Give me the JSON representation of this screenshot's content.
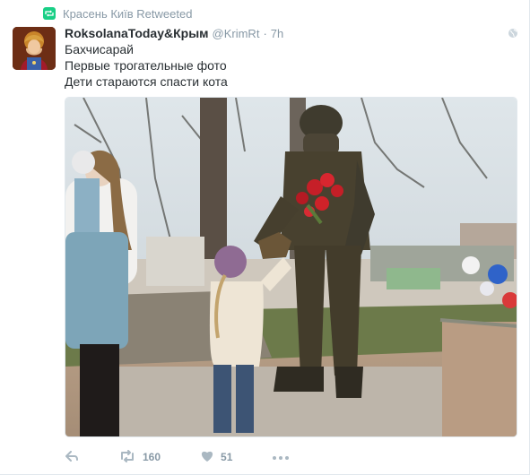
{
  "retweet": {
    "label": "Красень Київ Retweeted",
    "icon": "retweet-icon"
  },
  "tweet": {
    "author_name": "RoksolanaToday&Крым",
    "author_handle": "@KrimRt",
    "separator": "·",
    "time": "7h",
    "lines": [
      "Бахчисарай",
      "Первые трогательные фото",
      "Дети стараются спасти кота"
    ],
    "avatar_icon": "user-avatar",
    "globe_icon": "globe-icon"
  },
  "actions": {
    "reply_icon": "reply-icon",
    "retweet_icon": "retweet-icon",
    "retweet_count": "160",
    "like_icon": "heart-icon",
    "like_count": "51",
    "more_icon": "more-icon"
  },
  "colors": {
    "retweet_green": "#19cf86",
    "muted": "#8899a6",
    "text": "#292f33",
    "border": "#e1e8ed"
  }
}
